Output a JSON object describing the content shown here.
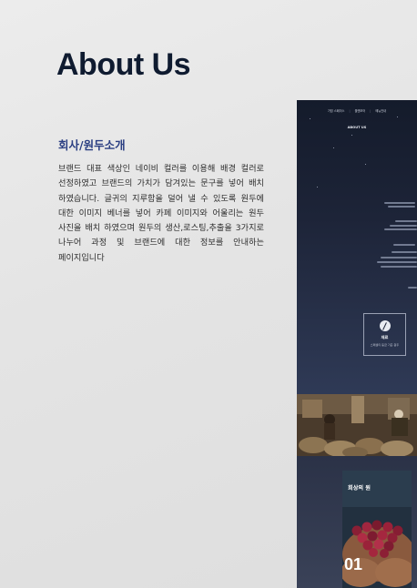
{
  "page": {
    "title": "About Us",
    "section_title": "회사/원두소개",
    "description": "브랜드 대표 색상인 네이비 컬러를 이용해 배경 컬러로 선정하였고 브랜드의 가치가 담겨있는 문구를 넣어 배치 하였습니다. 글귀의 지루함을 덜어 낼 수 있도록 원두에 대한 이미지 베너를 넣어 카페 이미지와 어울리는 원두 사진을 배치 하였으며 원두의 생산,로스팅,추출을 3가지로 나누어 과정 및 브랜드에 대한 정보를 안내하는 페이지입니다"
  },
  "mockup": {
    "nav": [
      "가밍 스페이스",
      "올앤모어",
      "메뉴안내"
    ],
    "hero_label": "ABOUT US",
    "info_title": "재료",
    "info_subtitle": "스페셜티 등급 기준 원두",
    "card_label": "회상의 원",
    "card_number": "01"
  },
  "colors": {
    "page_background": "#e6e6e6",
    "title": "#0f1b30",
    "accent_navy": "#2a3e82",
    "mockup_navy": "#1b2236"
  }
}
